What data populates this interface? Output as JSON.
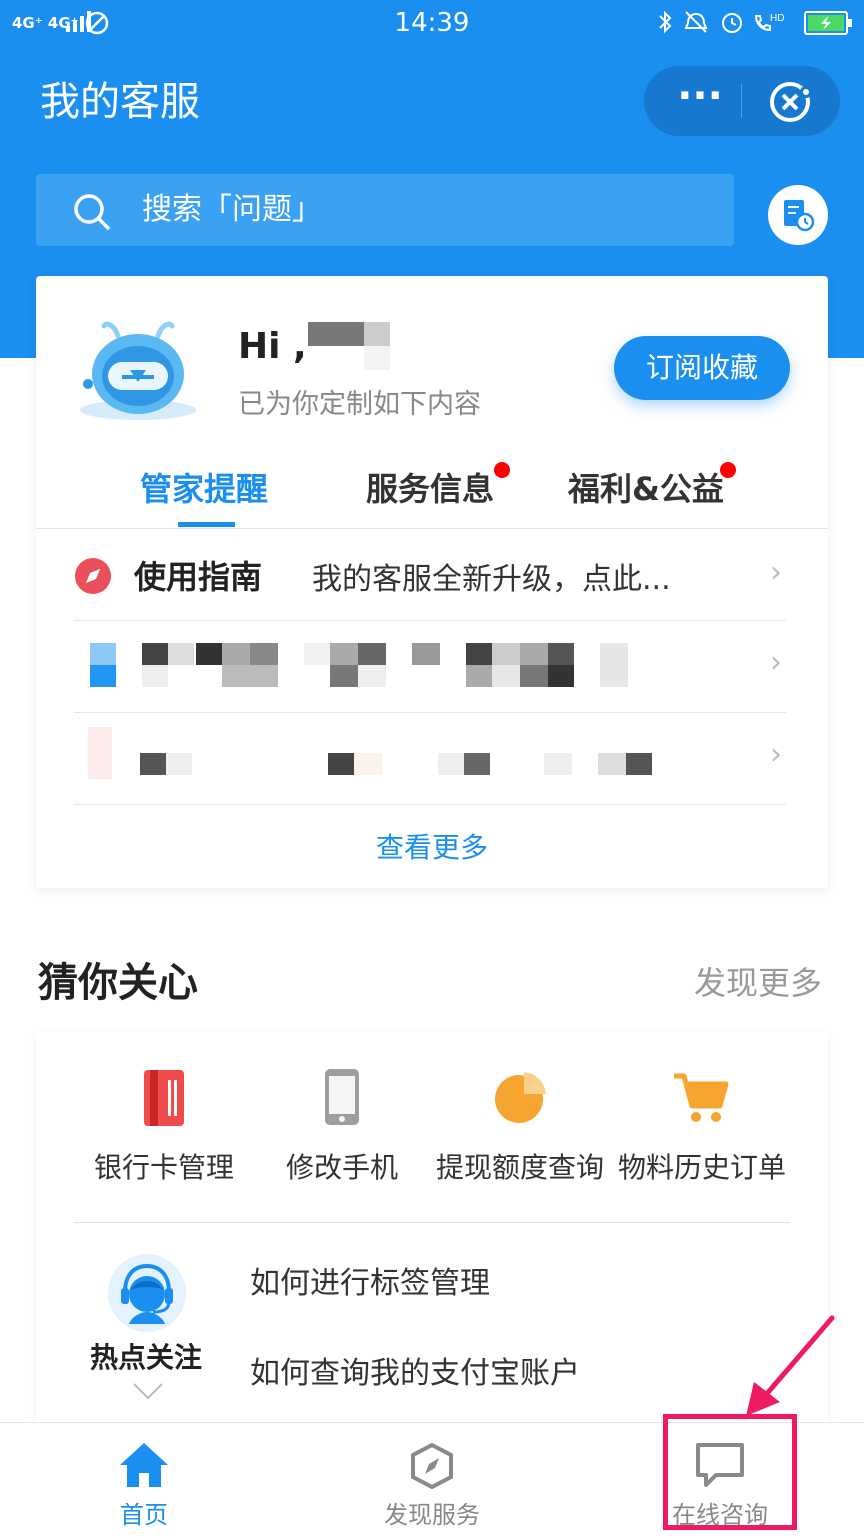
{
  "status_bar": {
    "network": "4G⁺ 4G⁺",
    "time": "14:39"
  },
  "header": {
    "title": "我的客服",
    "more_label": "···"
  },
  "search": {
    "placeholder": "搜索「问题」"
  },
  "greeting": {
    "hi": "Hi ,",
    "subtitle": "已为你定制如下内容",
    "subscribe_label": "订阅收藏"
  },
  "tabs": [
    {
      "label": "管家提醒",
      "active": true,
      "badge": false
    },
    {
      "label": "服务信息",
      "active": false,
      "badge": true
    },
    {
      "label": "福利&公益",
      "active": false,
      "badge": true
    }
  ],
  "reminders": {
    "guide_title": "使用指南",
    "guide_text": "我的客服全新升级，点此...",
    "see_more": "查看更多"
  },
  "care": {
    "title": "猜你关心",
    "more": "发现更多",
    "services": [
      {
        "label": "银行卡管理",
        "icon": "bank-card-icon"
      },
      {
        "label": "修改手机",
        "icon": "phone-icon"
      },
      {
        "label": "提现额度查询",
        "icon": "pie-chart-icon"
      },
      {
        "label": "物料历史订单",
        "icon": "cart-icon"
      }
    ],
    "hot_label": "热点关注",
    "hot_questions": [
      "如何进行标签管理",
      "如何查询我的支付宝账户"
    ]
  },
  "tab_bar": [
    {
      "label": "首页",
      "active": true
    },
    {
      "label": "发现服务",
      "active": false
    },
    {
      "label": "在线咨询",
      "active": false
    }
  ],
  "colors": {
    "brand_blue": "#1a8ff0",
    "highlight": "#ee1b62"
  }
}
